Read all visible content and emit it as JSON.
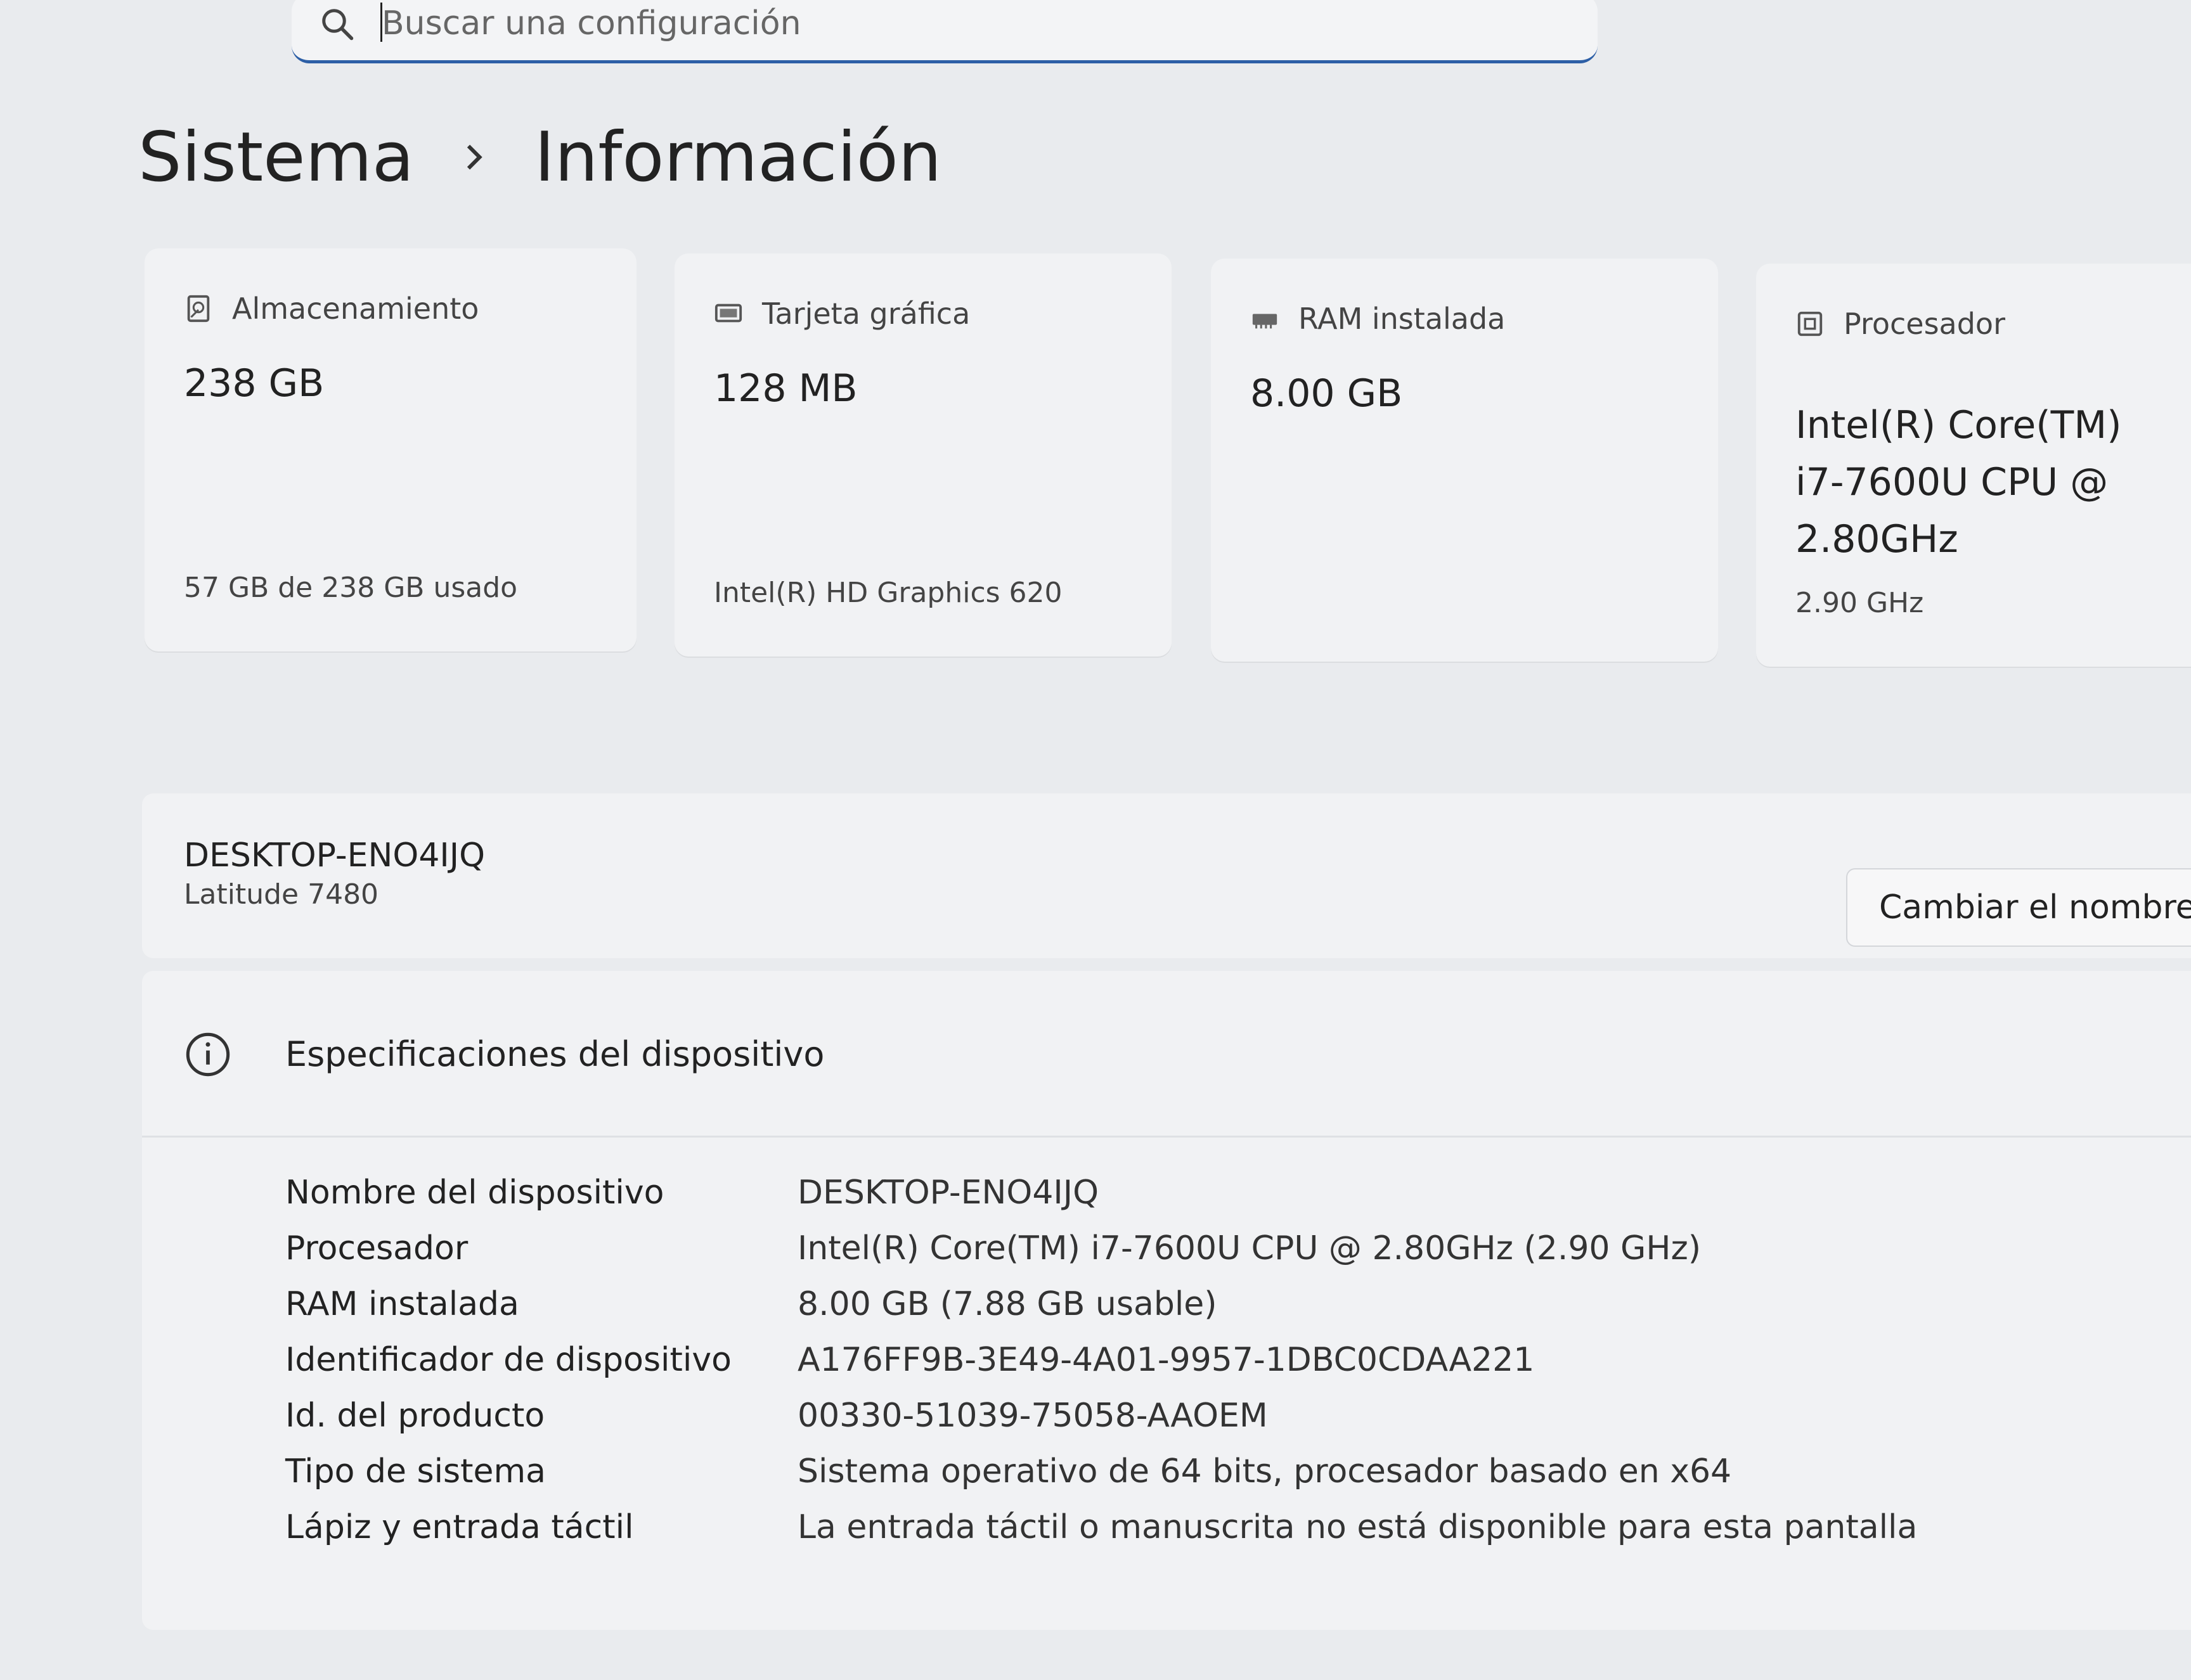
{
  "search": {
    "placeholder": "Buscar una configuración"
  },
  "breadcrumb": {
    "parent": "Sistema",
    "current": "Información"
  },
  "cards": [
    {
      "icon": "storage-icon",
      "label": "Almacenamiento",
      "value": "238 GB",
      "sub": "57 GB de 238 GB usado"
    },
    {
      "icon": "graphics-card-icon",
      "label": "Tarjeta gráfica",
      "value": "128 MB",
      "sub": "Intel(R) HD Graphics 620"
    },
    {
      "icon": "ram-icon",
      "label": "RAM instalada",
      "value": "8.00 GB",
      "sub": ""
    },
    {
      "icon": "processor-icon",
      "label": "Procesador",
      "value": "Intel(R) Core(TM) i7-7600U CPU @ 2.80GHz",
      "sub": "2.90 GHz"
    }
  ],
  "device": {
    "name": "DESKTOP-ENO4IJQ",
    "model": "Latitude 7480",
    "rename_label": "Cambiar el nombre"
  },
  "specs": {
    "title": "Especificaciones del dispositivo",
    "rows": [
      {
        "key": "Nombre del dispositivo",
        "value": "DESKTOP-ENO4IJQ"
      },
      {
        "key": "Procesador",
        "value": "Intel(R) Core(TM) i7-7600U CPU @ 2.80GHz (2.90 GHz)"
      },
      {
        "key": "RAM instalada",
        "value": "8.00 GB (7.88 GB usable)"
      },
      {
        "key": "Identificador de dispositivo",
        "value": "A176FF9B-3E49-4A01-9957-1DBC0CDAA221"
      },
      {
        "key": "Id. del producto",
        "value": "00330-51039-75058-AAOEM"
      },
      {
        "key": "Tipo de sistema",
        "value": "Sistema operativo de 64 bits, procesador basado en x64"
      },
      {
        "key": "Lápiz y entrada táctil",
        "value": "La entrada táctil o manuscrita no está disponible para esta pantalla"
      }
    ]
  }
}
